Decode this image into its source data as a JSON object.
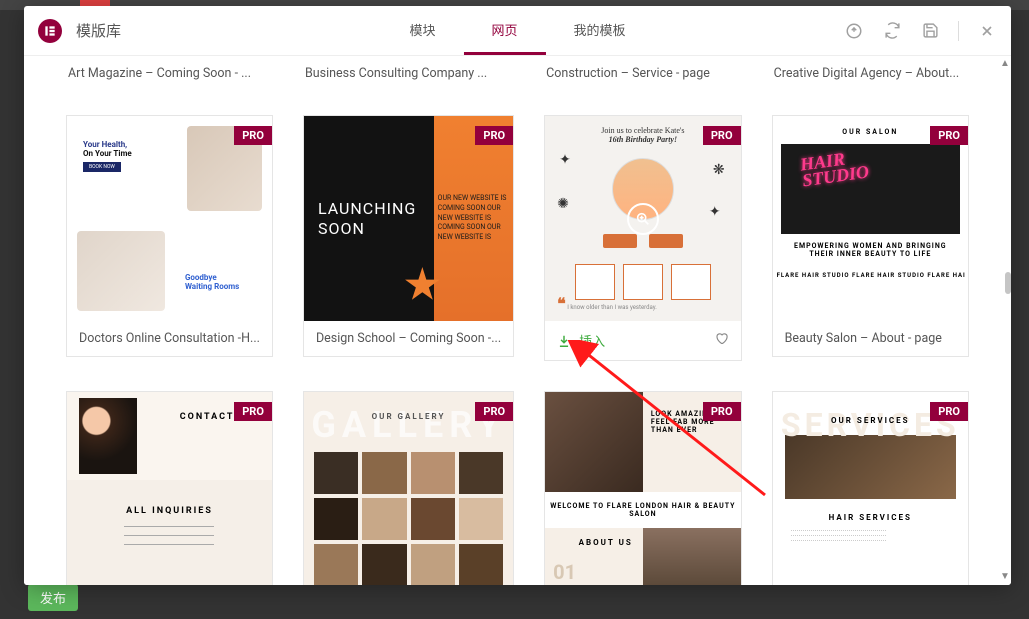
{
  "header": {
    "title": "模版库",
    "tabs": [
      "模块",
      "网页",
      "我的模板"
    ],
    "active_tab_index": 1
  },
  "backdrop": {
    "publish_btn": "发布"
  },
  "templates": {
    "row_partial": [
      {
        "title": "Art Magazine – Coming Soon - ..."
      },
      {
        "title": "Business Consulting Company ..."
      },
      {
        "title": "Construction – Service - page"
      },
      {
        "title": "Creative Digital Agency – About..."
      }
    ],
    "row_full_1": [
      {
        "title": "Doctors Online Consultation -H...",
        "pro": true,
        "mock": {
          "line1": "Your Health,",
          "line2": "On Your Time",
          "btn": "BOOK NOW",
          "note_h": "Goodbye",
          "note_sub": "Waiting Rooms"
        }
      },
      {
        "title": "Design School – Coming Soon -...",
        "pro": true,
        "mock": {
          "h1": "LAUNCHING",
          "h2": "SOON",
          "scroll": "OUR NEW WEBSITE IS COMING SOON OUR NEW WEBSITE IS COMING SOON OUR NEW WEBSITE IS"
        }
      },
      {
        "insert_label": "插入",
        "pro": true,
        "hovered": true,
        "mock": {
          "banner1": "Join us to celebrate Kate's",
          "banner2": "16th Birthday Party!",
          "quote": "I know older than I was yesterday."
        }
      },
      {
        "title": "Beauty Salon – About - page",
        "pro": true,
        "mock": {
          "top": "OUR SALON",
          "neon1": "HAIR",
          "neon2": "STUDIO",
          "tagline": "EMPOWERING WOMEN AND BRINGING THEIR INNER BEAUTY TO LIFE",
          "marquee": "FLARE HAIR STUDIO FLARE HAIR STUDIO FLARE HAI"
        }
      }
    ],
    "row_full_2": [
      {
        "pro": true,
        "mock": {
          "h1": "CONTACT US",
          "h2": "ALL INQUIRIES"
        }
      },
      {
        "pro": true,
        "mock": {
          "h1": "OUR GALLERY",
          "ghost": "GALLERY"
        }
      },
      {
        "pro": true,
        "mock": {
          "t1": "LOOK AMAZING & FEEL FAB MORE THAN EVER",
          "welcome": "WELCOME TO FLARE LONDON HAIR & BEAUTY SALON",
          "num": "01",
          "about": "ABOUT US"
        }
      },
      {
        "pro": true,
        "mock": {
          "ghost": "SERVICES",
          "h1": "OUR SERVICES",
          "h2": "HAIR SERVICES"
        }
      }
    ]
  },
  "badges": {
    "pro": "PRO"
  }
}
